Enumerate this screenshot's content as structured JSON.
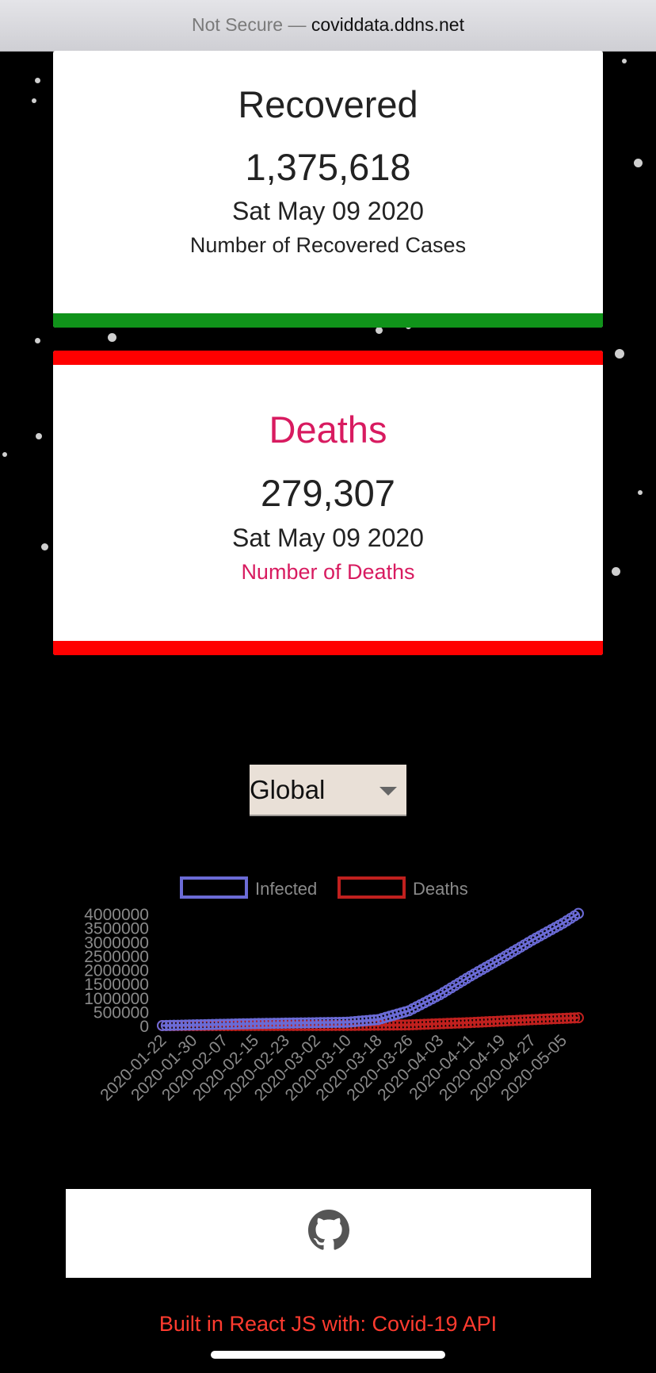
{
  "browser": {
    "security": "Not Secure",
    "separator": " — ",
    "domain": "coviddata.ddns.net"
  },
  "recovered": {
    "title": "Recovered",
    "value": "1,375,618",
    "date": "Sat May 09 2020",
    "desc": "Number of Recovered Cases",
    "accent": "#10931a"
  },
  "deaths": {
    "title": "Deaths",
    "value": "279,307",
    "date": "Sat May 09 2020",
    "desc": "Number of Deaths",
    "accent": "#ff0000",
    "title_color": "#d81b60"
  },
  "select": {
    "value": "Global"
  },
  "chart_data": {
    "type": "line",
    "legend": [
      "Infected",
      "Deaths"
    ],
    "legend_placement": "top",
    "yticks": [
      "4000000",
      "3500000",
      "3000000",
      "2500000",
      "2000000",
      "1500000",
      "1000000",
      "500000",
      "0"
    ],
    "xticks": [
      "2020-01-22",
      "2020-01-30",
      "2020-02-07",
      "2020-02-15",
      "2020-02-23",
      "2020-03-02",
      "2020-03-10",
      "2020-03-18",
      "2020-03-26",
      "2020-04-03",
      "2020-04-11",
      "2020-04-19",
      "2020-04-27",
      "2020-05-05"
    ],
    "ylim": [
      0,
      4000000
    ],
    "series": [
      {
        "name": "Infected",
        "color": "#6b6bd6",
        "x": [
          "2020-01-22",
          "2020-02-15",
          "2020-03-10",
          "2020-03-18",
          "2020-03-26",
          "2020-04-03",
          "2020-04-11",
          "2020-04-19",
          "2020-04-27",
          "2020-05-05",
          "2020-05-09"
        ],
        "values": [
          555,
          71000,
          119000,
          214000,
          530000,
          1100000,
          1770000,
          2400000,
          3050000,
          3660000,
          4010000
        ]
      },
      {
        "name": "Deaths",
        "color": "#c0201e",
        "x": [
          "2020-01-22",
          "2020-03-10",
          "2020-03-26",
          "2020-04-11",
          "2020-04-27",
          "2020-05-09"
        ],
        "values": [
          17,
          4262,
          24000,
          108000,
          211000,
          279307
        ]
      }
    ]
  },
  "footer": {
    "icon": "github-icon",
    "credit": "Built in React JS with: Covid-19 API"
  }
}
